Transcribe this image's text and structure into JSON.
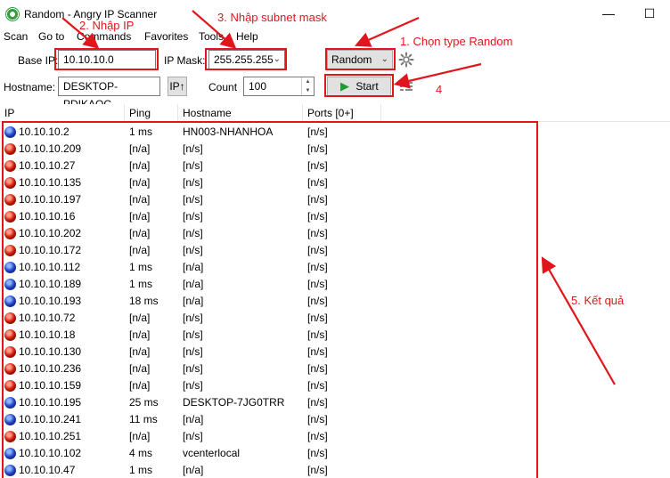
{
  "window": {
    "title": "Random - Angry IP Scanner",
    "minimize_glyph": "—",
    "maximize_glyph": "☐"
  },
  "menu": [
    "Scan",
    "Go to",
    "Commands",
    "Favorites",
    "Tools",
    "Help"
  ],
  "toolbar": {
    "base_ip_label": "Base IP:",
    "base_ip_value": "10.10.10.0",
    "ip_mask_label": "IP Mask:",
    "ip_mask_value": "255.255.255",
    "feeder_type": "Random",
    "hostname_label": "Hostname:",
    "hostname_value": "DESKTOP-PDIKAQC",
    "ip_up_button": "IP↑",
    "count_label": "Count",
    "count_value": "100",
    "start_button": "Start"
  },
  "annotations": {
    "step1": "1. Chọn type Random",
    "step2": "2. Nhập IP",
    "step3": "3. Nhập subnet mask",
    "step4": "4",
    "step5": "5. Kết quả",
    "color": "#e0161c"
  },
  "table": {
    "columns": [
      "IP",
      "Ping",
      "Hostname",
      "Ports [0+]"
    ],
    "rows": [
      {
        "status": "alive",
        "ip": "10.10.10.2",
        "ping": "1 ms",
        "hostname": "HN003-NHANHOA",
        "ports": "[n/s]"
      },
      {
        "status": "dead",
        "ip": "10.10.10.209",
        "ping": "[n/a]",
        "hostname": "[n/s]",
        "ports": "[n/s]"
      },
      {
        "status": "dead",
        "ip": "10.10.10.27",
        "ping": "[n/a]",
        "hostname": "[n/s]",
        "ports": "[n/s]"
      },
      {
        "status": "dead",
        "ip": "10.10.10.135",
        "ping": "[n/a]",
        "hostname": "[n/s]",
        "ports": "[n/s]"
      },
      {
        "status": "dead",
        "ip": "10.10.10.197",
        "ping": "[n/a]",
        "hostname": "[n/s]",
        "ports": "[n/s]"
      },
      {
        "status": "dead",
        "ip": "10.10.10.16",
        "ping": "[n/a]",
        "hostname": "[n/s]",
        "ports": "[n/s]"
      },
      {
        "status": "dead",
        "ip": "10.10.10.202",
        "ping": "[n/a]",
        "hostname": "[n/s]",
        "ports": "[n/s]"
      },
      {
        "status": "dead",
        "ip": "10.10.10.172",
        "ping": "[n/a]",
        "hostname": "[n/s]",
        "ports": "[n/s]"
      },
      {
        "status": "alive",
        "ip": "10.10.10.112",
        "ping": "1 ms",
        "hostname": "[n/a]",
        "ports": "[n/s]"
      },
      {
        "status": "alive",
        "ip": "10.10.10.189",
        "ping": "1 ms",
        "hostname": "[n/a]",
        "ports": "[n/s]"
      },
      {
        "status": "alive",
        "ip": "10.10.10.193",
        "ping": "18 ms",
        "hostname": "[n/a]",
        "ports": "[n/s]"
      },
      {
        "status": "dead",
        "ip": "10.10.10.72",
        "ping": "[n/a]",
        "hostname": "[n/s]",
        "ports": "[n/s]"
      },
      {
        "status": "dead",
        "ip": "10.10.10.18",
        "ping": "[n/a]",
        "hostname": "[n/s]",
        "ports": "[n/s]"
      },
      {
        "status": "dead",
        "ip": "10.10.10.130",
        "ping": "[n/a]",
        "hostname": "[n/s]",
        "ports": "[n/s]"
      },
      {
        "status": "dead",
        "ip": "10.10.10.236",
        "ping": "[n/a]",
        "hostname": "[n/s]",
        "ports": "[n/s]"
      },
      {
        "status": "dead",
        "ip": "10.10.10.159",
        "ping": "[n/a]",
        "hostname": "[n/s]",
        "ports": "[n/s]"
      },
      {
        "status": "alive",
        "ip": "10.10.10.195",
        "ping": "25 ms",
        "hostname": "DESKTOP-7JG0TRR",
        "ports": "[n/s]"
      },
      {
        "status": "alive",
        "ip": "10.10.10.241",
        "ping": "11 ms",
        "hostname": "[n/a]",
        "ports": "[n/s]"
      },
      {
        "status": "dead",
        "ip": "10.10.10.251",
        "ping": "[n/a]",
        "hostname": "[n/s]",
        "ports": "[n/s]"
      },
      {
        "status": "alive",
        "ip": "10.10.10.102",
        "ping": "4 ms",
        "hostname": "vcenterlocal",
        "ports": "[n/s]"
      },
      {
        "status": "alive",
        "ip": "10.10.10.47",
        "ping": "1 ms",
        "hostname": "[n/a]",
        "ports": "[n/s]"
      }
    ]
  }
}
